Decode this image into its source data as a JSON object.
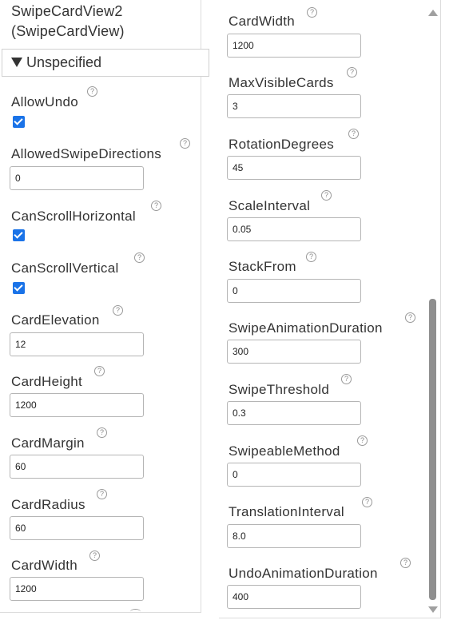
{
  "component": {
    "name": "SwipeCardView2",
    "type": "(SwipeCardView)"
  },
  "group": {
    "label": "Unspecified",
    "expand_icon": "triangle-down-icon"
  },
  "help_glyph": "?",
  "left_properties": [
    {
      "name": "AllowUndo",
      "kind": "checkbox",
      "checked": true
    },
    {
      "name": "AllowedSwipeDirections",
      "kind": "text",
      "value": "0"
    },
    {
      "name": "CanScrollHorizontal",
      "kind": "checkbox",
      "checked": true
    },
    {
      "name": "CanScrollVertical",
      "kind": "checkbox",
      "checked": true
    },
    {
      "name": "CardElevation",
      "kind": "text",
      "value": "12"
    },
    {
      "name": "CardHeight",
      "kind": "text",
      "value": "1200"
    },
    {
      "name": "CardMargin",
      "kind": "text",
      "value": "60"
    },
    {
      "name": "CardRadius",
      "kind": "text",
      "value": "60"
    },
    {
      "name": "CardWidth",
      "kind": "text",
      "value": "1200"
    }
  ],
  "right_properties": [
    {
      "name": "CardWidth",
      "kind": "text",
      "value": "1200"
    },
    {
      "name": "MaxVisibleCards",
      "kind": "text",
      "value": "3"
    },
    {
      "name": "RotationDegrees",
      "kind": "text",
      "value": "45"
    },
    {
      "name": "ScaleInterval",
      "kind": "text",
      "value": "0.05"
    },
    {
      "name": "StackFrom",
      "kind": "text",
      "value": "0"
    },
    {
      "name": "SwipeAnimationDuration",
      "kind": "text",
      "value": "300"
    },
    {
      "name": "SwipeThreshold",
      "kind": "text",
      "value": "0.3"
    },
    {
      "name": "SwipeableMethod",
      "kind": "text",
      "value": "0"
    },
    {
      "name": "TranslationInterval",
      "kind": "text",
      "value": "8.0"
    },
    {
      "name": "UndoAnimationDuration",
      "kind": "text",
      "value": "400"
    }
  ],
  "colors": {
    "checkbox": "#1a73e8",
    "scrollbar_thumb": "#8f8f8f",
    "text": "#333333"
  }
}
